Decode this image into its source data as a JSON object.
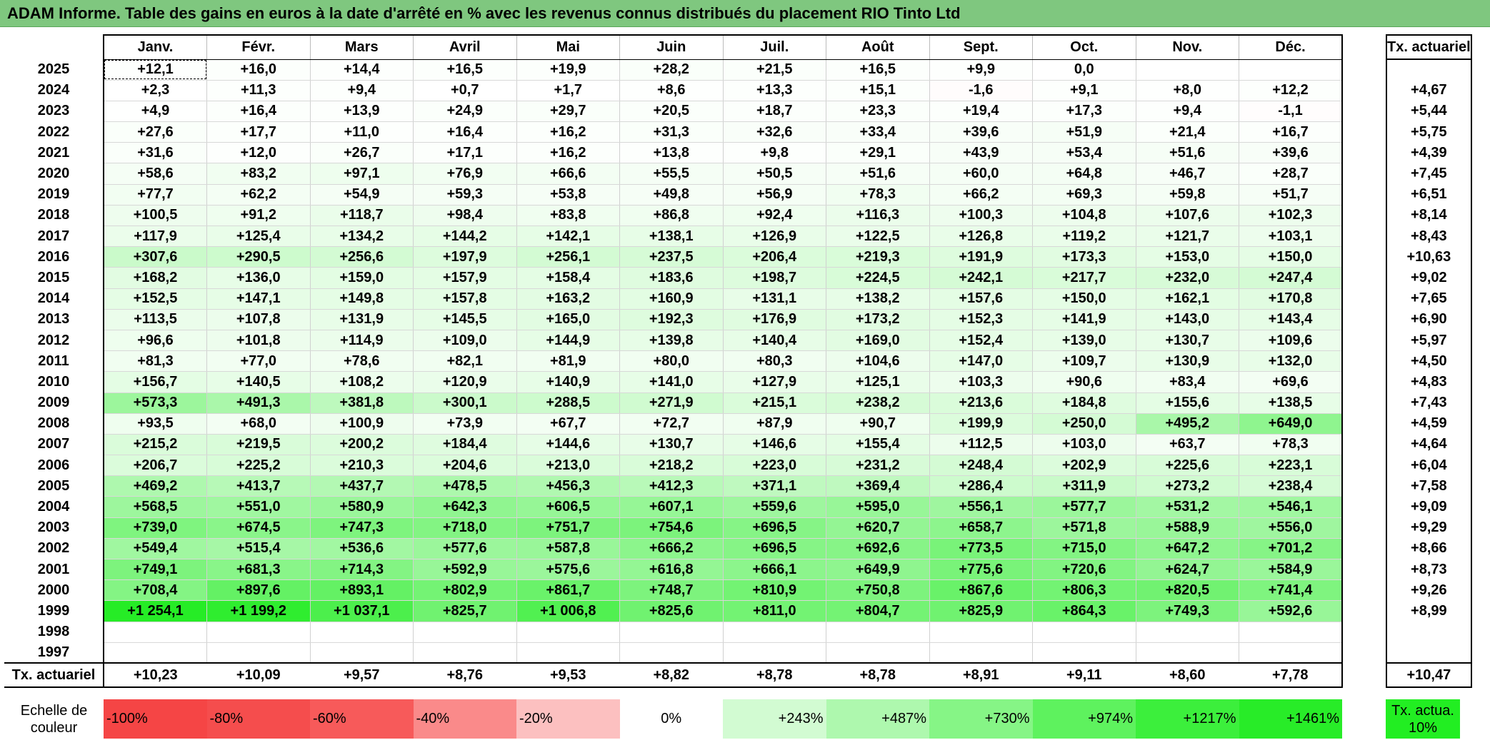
{
  "title": "ADAM Informe. Table des gains en euros à la date d'arrêté en % avec les revenus connus distribués du placement RIO Tinto Ltd",
  "months": [
    "Janv.",
    "Févr.",
    "Mars",
    "Avril",
    "Mai",
    "Juin",
    "Juil.",
    "Août",
    "Sept.",
    "Oct.",
    "Nov.",
    "Déc."
  ],
  "side_header": "Tx. actuariel",
  "rows": [
    {
      "year": "2025",
      "values": [
        "+12,1",
        "+16,0",
        "+14,4",
        "+16,5",
        "+19,9",
        "+28,2",
        "+21,5",
        "+16,5",
        "+9,9",
        "0,0",
        "",
        ""
      ],
      "rate": ""
    },
    {
      "year": "2024",
      "values": [
        "+2,3",
        "+11,3",
        "+9,4",
        "+0,7",
        "+1,7",
        "+8,6",
        "+13,3",
        "+15,1",
        "-1,6",
        "+9,1",
        "+8,0",
        "+12,2"
      ],
      "rate": "+4,67"
    },
    {
      "year": "2023",
      "values": [
        "+4,9",
        "+16,4",
        "+13,9",
        "+24,9",
        "+29,7",
        "+20,5",
        "+18,7",
        "+23,3",
        "+19,4",
        "+17,3",
        "+9,4",
        "-1,1"
      ],
      "rate": "+5,44"
    },
    {
      "year": "2022",
      "values": [
        "+27,6",
        "+17,7",
        "+11,0",
        "+16,4",
        "+16,2",
        "+31,3",
        "+32,6",
        "+33,4",
        "+39,6",
        "+51,9",
        "+21,4",
        "+16,7"
      ],
      "rate": "+5,75"
    },
    {
      "year": "2021",
      "values": [
        "+31,6",
        "+12,0",
        "+26,7",
        "+17,1",
        "+16,2",
        "+13,8",
        "+9,8",
        "+29,1",
        "+43,9",
        "+53,4",
        "+51,6",
        "+39,6"
      ],
      "rate": "+4,39"
    },
    {
      "year": "2020",
      "values": [
        "+58,6",
        "+83,2",
        "+97,1",
        "+76,9",
        "+66,6",
        "+55,5",
        "+50,5",
        "+51,6",
        "+60,0",
        "+64,8",
        "+46,7",
        "+28,7"
      ],
      "rate": "+7,45"
    },
    {
      "year": "2019",
      "values": [
        "+77,7",
        "+62,2",
        "+54,9",
        "+59,3",
        "+53,8",
        "+49,8",
        "+56,9",
        "+78,3",
        "+66,2",
        "+69,3",
        "+59,8",
        "+51,7"
      ],
      "rate": "+6,51"
    },
    {
      "year": "2018",
      "values": [
        "+100,5",
        "+91,2",
        "+118,7",
        "+98,4",
        "+83,8",
        "+86,8",
        "+92,4",
        "+116,3",
        "+100,3",
        "+104,8",
        "+107,6",
        "+102,3"
      ],
      "rate": "+8,14"
    },
    {
      "year": "2017",
      "values": [
        "+117,9",
        "+125,4",
        "+134,2",
        "+144,2",
        "+142,1",
        "+138,1",
        "+126,9",
        "+122,5",
        "+126,8",
        "+119,2",
        "+121,7",
        "+103,1"
      ],
      "rate": "+8,43"
    },
    {
      "year": "2016",
      "values": [
        "+307,6",
        "+290,5",
        "+256,6",
        "+197,9",
        "+256,1",
        "+237,5",
        "+206,4",
        "+219,3",
        "+191,9",
        "+173,3",
        "+153,0",
        "+150,0"
      ],
      "rate": "+10,63"
    },
    {
      "year": "2015",
      "values": [
        "+168,2",
        "+136,0",
        "+159,0",
        "+157,9",
        "+158,4",
        "+183,6",
        "+198,7",
        "+224,5",
        "+242,1",
        "+217,7",
        "+232,0",
        "+247,4"
      ],
      "rate": "+9,02"
    },
    {
      "year": "2014",
      "values": [
        "+152,5",
        "+147,1",
        "+149,8",
        "+157,8",
        "+163,2",
        "+160,9",
        "+131,1",
        "+138,2",
        "+157,6",
        "+150,0",
        "+162,1",
        "+170,8"
      ],
      "rate": "+7,65"
    },
    {
      "year": "2013",
      "values": [
        "+113,5",
        "+107,8",
        "+131,9",
        "+145,5",
        "+165,0",
        "+192,3",
        "+176,9",
        "+173,2",
        "+152,3",
        "+141,9",
        "+143,0",
        "+143,4"
      ],
      "rate": "+6,90"
    },
    {
      "year": "2012",
      "values": [
        "+96,6",
        "+101,8",
        "+114,9",
        "+109,0",
        "+144,9",
        "+139,8",
        "+140,4",
        "+169,0",
        "+152,4",
        "+139,0",
        "+130,7",
        "+109,6"
      ],
      "rate": "+5,97"
    },
    {
      "year": "2011",
      "values": [
        "+81,3",
        "+77,0",
        "+78,6",
        "+82,1",
        "+81,9",
        "+80,0",
        "+80,3",
        "+104,6",
        "+147,0",
        "+109,7",
        "+130,9",
        "+132,0"
      ],
      "rate": "+4,50"
    },
    {
      "year": "2010",
      "values": [
        "+156,7",
        "+140,5",
        "+108,2",
        "+120,9",
        "+140,9",
        "+141,0",
        "+127,9",
        "+125,1",
        "+103,3",
        "+90,6",
        "+83,4",
        "+69,6"
      ],
      "rate": "+4,83"
    },
    {
      "year": "2009",
      "values": [
        "+573,3",
        "+491,3",
        "+381,8",
        "+300,1",
        "+288,5",
        "+271,9",
        "+215,1",
        "+238,2",
        "+213,6",
        "+184,8",
        "+155,6",
        "+138,5"
      ],
      "rate": "+7,43"
    },
    {
      "year": "2008",
      "values": [
        "+93,5",
        "+68,0",
        "+100,9",
        "+73,9",
        "+67,7",
        "+72,7",
        "+87,9",
        "+90,7",
        "+199,9",
        "+250,0",
        "+495,2",
        "+649,0"
      ],
      "rate": "+4,59"
    },
    {
      "year": "2007",
      "values": [
        "+215,2",
        "+219,5",
        "+200,2",
        "+184,4",
        "+144,6",
        "+130,7",
        "+146,6",
        "+155,4",
        "+112,5",
        "+103,0",
        "+63,7",
        "+78,3"
      ],
      "rate": "+4,64"
    },
    {
      "year": "2006",
      "values": [
        "+206,7",
        "+225,2",
        "+210,3",
        "+204,6",
        "+213,0",
        "+218,2",
        "+223,0",
        "+231,2",
        "+248,4",
        "+202,9",
        "+225,6",
        "+223,1"
      ],
      "rate": "+6,04"
    },
    {
      "year": "2005",
      "values": [
        "+469,2",
        "+413,7",
        "+437,7",
        "+478,5",
        "+456,3",
        "+412,3",
        "+371,1",
        "+369,4",
        "+286,4",
        "+311,9",
        "+273,2",
        "+238,4"
      ],
      "rate": "+7,58"
    },
    {
      "year": "2004",
      "values": [
        "+568,5",
        "+551,0",
        "+580,9",
        "+642,3",
        "+606,5",
        "+607,1",
        "+559,6",
        "+595,0",
        "+556,1",
        "+577,7",
        "+531,2",
        "+546,1"
      ],
      "rate": "+9,09"
    },
    {
      "year": "2003",
      "values": [
        "+739,0",
        "+674,5",
        "+747,3",
        "+718,0",
        "+751,7",
        "+754,6",
        "+696,5",
        "+620,7",
        "+658,7",
        "+571,8",
        "+588,9",
        "+556,0"
      ],
      "rate": "+9,29"
    },
    {
      "year": "2002",
      "values": [
        "+549,4",
        "+515,4",
        "+536,6",
        "+577,6",
        "+587,8",
        "+666,2",
        "+696,5",
        "+692,6",
        "+773,5",
        "+715,0",
        "+647,2",
        "+701,2"
      ],
      "rate": "+8,66"
    },
    {
      "year": "2001",
      "values": [
        "+749,1",
        "+681,3",
        "+714,3",
        "+592,9",
        "+575,6",
        "+616,8",
        "+666,1",
        "+649,9",
        "+775,6",
        "+720,6",
        "+624,7",
        "+584,9"
      ],
      "rate": "+8,73"
    },
    {
      "year": "2000",
      "values": [
        "+708,4",
        "+897,6",
        "+893,1",
        "+802,9",
        "+861,7",
        "+748,7",
        "+810,9",
        "+750,8",
        "+867,6",
        "+806,3",
        "+820,5",
        "+741,4"
      ],
      "rate": "+9,26"
    },
    {
      "year": "1999",
      "values": [
        "+1 254,1",
        "+1 199,2",
        "+1 037,1",
        "+825,7",
        "+1 006,8",
        "+825,6",
        "+811,0",
        "+804,7",
        "+825,9",
        "+864,3",
        "+749,3",
        "+592,6"
      ],
      "rate": "+8,99"
    },
    {
      "year": "1998",
      "values": [
        "",
        "",
        "",
        "",
        "",
        "",
        "",
        "",
        "",
        "",
        "",
        ""
      ],
      "rate": ""
    },
    {
      "year": "1997",
      "values": [
        "",
        "",
        "",
        "",
        "",
        "",
        "",
        "",
        "",
        "",
        "",
        ""
      ],
      "rate": ""
    }
  ],
  "footer": {
    "label": "Tx. actuariel",
    "values": [
      "+10,23",
      "+10,09",
      "+9,57",
      "+8,76",
      "+9,53",
      "+8,82",
      "+8,78",
      "+8,78",
      "+8,91",
      "+9,11",
      "+8,60",
      "+7,78"
    ],
    "total": "+10,47"
  },
  "scale": {
    "label": "Echelle de couleur",
    "items": [
      {
        "label": "-100%",
        "color": "#f54545"
      },
      {
        "label": "-80%",
        "color": "#f54d4d"
      },
      {
        "label": "-60%",
        "color": "#f75a5a"
      },
      {
        "label": "-40%",
        "color": "#fa8a8a"
      },
      {
        "label": "-20%",
        "color": "#fcc0c0"
      },
      {
        "label": "0%",
        "color": "#ffffff"
      },
      {
        "label": "+243%",
        "color": "#d2fbd2"
      },
      {
        "label": "+487%",
        "color": "#aef8ae"
      },
      {
        "label": "+730%",
        "color": "#86f586"
      },
      {
        "label": "+974%",
        "color": "#5ef25e"
      },
      {
        "label": "+1217%",
        "color": "#3cef3c"
      },
      {
        "label": "+1461%",
        "color": "#28ec28"
      }
    ],
    "side_label": "Tx. actua. 10%"
  }
}
